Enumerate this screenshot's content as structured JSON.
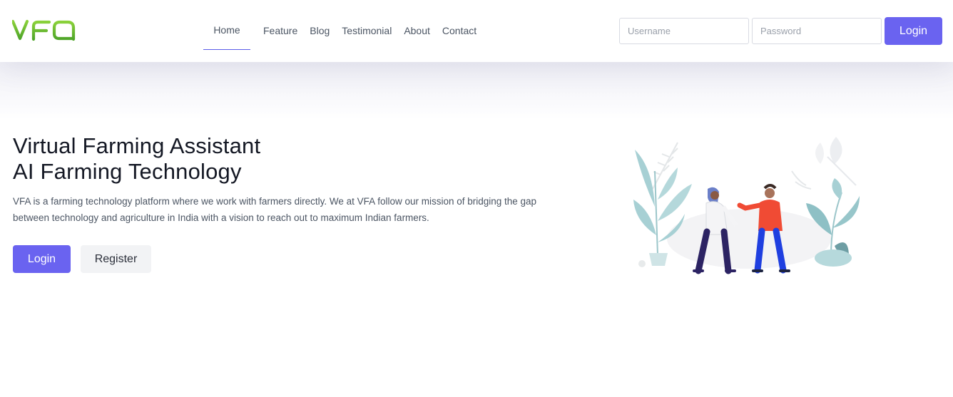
{
  "brand": {
    "logo_text": "VFA"
  },
  "nav": {
    "items": [
      {
        "label": "Home",
        "active": true
      },
      {
        "label": "Feature"
      },
      {
        "label": "Blog"
      },
      {
        "label": "Testimonial"
      },
      {
        "label": "About"
      },
      {
        "label": "Contact"
      }
    ],
    "accent_color": "#5b5ce9"
  },
  "login_form": {
    "username_placeholder": "Username",
    "password_placeholder": "Password",
    "submit_label": "Login"
  },
  "hero": {
    "title_line1": "Virtual Farming Assistant",
    "title_line2": "AI Farming Technology",
    "description": "VFA is a farming technology platform where we work with farmers directly. We at VFA follow our mission of bridging the gap between technology and agriculture in India with a vision to reach out to maximum Indian farmers.",
    "login_label": "Login",
    "register_label": "Register",
    "illustration": "two-people-talking-with-plants"
  },
  "colors": {
    "primary": "#6a63f0",
    "logo_green": "#6cbf2e"
  }
}
